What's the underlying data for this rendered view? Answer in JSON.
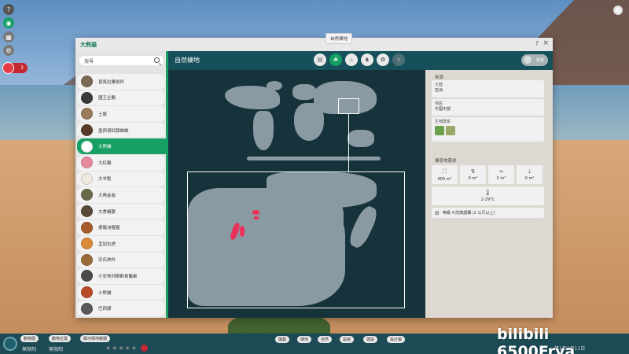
{
  "window": {
    "title": "大熊貓",
    "help": "?",
    "close": "×",
    "tooltip": "自然棲地"
  },
  "hud": {
    "help": "?",
    "badge_count": "3"
  },
  "sidebar": {
    "search_placeholder": "搜尋",
    "items": [
      {
        "label": "喜馬拉雅斑羚",
        "color": "#7a6a55"
      },
      {
        "label": "國王企鵝",
        "color": "#3a3a3a"
      },
      {
        "label": "土豚",
        "color": "#9b7a5a"
      },
      {
        "label": "墨西哥紅膝蜘蛛",
        "color": "#5a3a2a"
      },
      {
        "label": "大熊貓",
        "color": "#ffffff",
        "active": true
      },
      {
        "label": "大紅鸛",
        "color": "#e78aa0"
      },
      {
        "label": "大羊駝",
        "color": "#efe8dc"
      },
      {
        "label": "大角金龜",
        "color": "#6a6a4a"
      },
      {
        "label": "大食蟻獸",
        "color": "#5a4a3a"
      },
      {
        "label": "婆羅洲猩猩",
        "color": "#a85a2a"
      },
      {
        "label": "孟加拉虎",
        "color": "#d98a3a"
      },
      {
        "label": "安氏林羚",
        "color": "#9a6a3a"
      },
      {
        "label": "小安地列斯群島鬣蜥",
        "color": "#4a4a4a"
      },
      {
        "label": "小熊貓",
        "color": "#b84a2a"
      },
      {
        "label": "巴西貘",
        "color": "#5a5a5a"
      }
    ]
  },
  "content": {
    "title": "自然棲地",
    "tabs": [
      "info-icon",
      "habitat-icon",
      "diet-icon",
      "animal-icon",
      "paw-icon",
      "trophy-icon"
    ],
    "header_button": "職業"
  },
  "info": {
    "origin_title": "來源",
    "continent_label": "大陸",
    "continent_value": "亞洲",
    "region_label": "地區",
    "region_value": "中國中部",
    "biome_label": "生物群系",
    "requirements_title": "棲息地需求",
    "land_area": "900 m²",
    "climbing_area": "0 m²",
    "water_area": "0 m²",
    "deep_water_area": "0 m²",
    "temperature": "2-29°C",
    "fence": "等級 4 防爬護欄 (2 公尺以上)"
  },
  "bottom": {
    "animals_button": "動物園",
    "animals_filter": "動物位置",
    "show_habitats": "顯示棲地範圍",
    "unlimited_1": "無限制",
    "unlimited_2": "無限制",
    "nav": [
      "園藝",
      "棲地",
      "自然",
      "設施",
      "建設",
      "設計圖"
    ],
    "date": "第1年1月11日",
    "watermark": "bilibili 6500Frya"
  }
}
